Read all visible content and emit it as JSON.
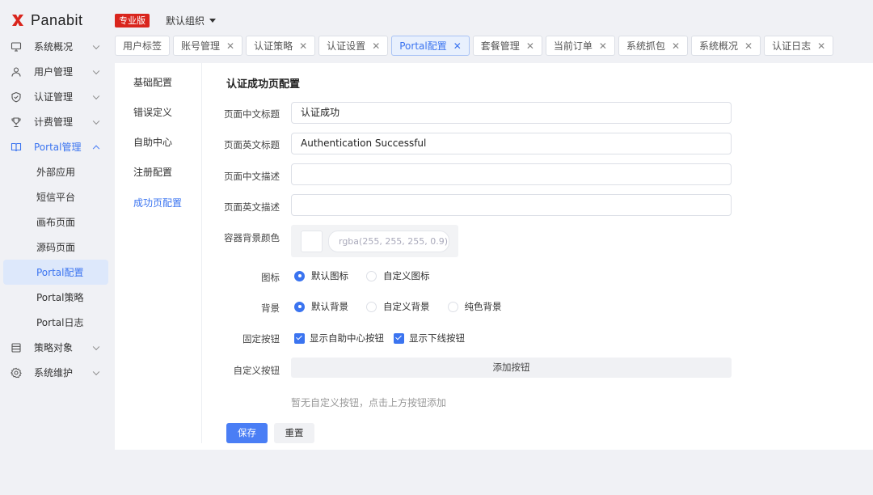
{
  "brand": {
    "name": "Panabit",
    "edition_badge": "专业版",
    "accent": "#d9251d"
  },
  "header": {
    "org_selector": "默认组织"
  },
  "sidebar": {
    "items": [
      {
        "label": "系统概况",
        "icon": "monitor-icon"
      },
      {
        "label": "用户管理",
        "icon": "user-icon"
      },
      {
        "label": "认证管理",
        "icon": "shield-icon"
      },
      {
        "label": "计费管理",
        "icon": "trophy-icon"
      },
      {
        "label": "Portal管理",
        "icon": "book-icon",
        "expanded": true
      },
      {
        "label": "策略对象",
        "icon": "list-icon"
      },
      {
        "label": "系统维护",
        "icon": "gear-icon"
      }
    ],
    "portal_sub": [
      "外部应用",
      "短信平台",
      "画布页面",
      "源码页面",
      "Portal配置",
      "Portal策略",
      "Portal日志"
    ],
    "active_sub": "Portal配置"
  },
  "tabs": [
    {
      "label": "用户标签",
      "closable": false
    },
    {
      "label": "账号管理",
      "closable": true
    },
    {
      "label": "认证策略",
      "closable": true
    },
    {
      "label": "认证设置",
      "closable": true
    },
    {
      "label": "Portal配置",
      "closable": true,
      "active": true
    },
    {
      "label": "套餐管理",
      "closable": true
    },
    {
      "label": "当前订单",
      "closable": true
    },
    {
      "label": "系统抓包",
      "closable": true
    },
    {
      "label": "系统概况",
      "closable": true
    },
    {
      "label": "认证日志",
      "closable": true
    }
  ],
  "subnav": [
    "基础配置",
    "错误定义",
    "自助中心",
    "注册配置",
    "成功页配置"
  ],
  "subnav_active": "成功页配置",
  "form": {
    "title": "认证成功页配置",
    "cn_title_label": "页面中文标题",
    "cn_title_value": "认证成功",
    "en_title_label": "页面英文标题",
    "en_title_value": "Authentication Successful",
    "cn_desc_label": "页面中文描述",
    "cn_desc_value": "",
    "en_desc_label": "页面英文描述",
    "en_desc_value": "",
    "bg_color_label": "容器背景颜色",
    "bg_color_placeholder": "rgba(255, 255, 255, 0.9)",
    "icon_label": "图标",
    "icon_options": [
      "默认图标",
      "自定义图标"
    ],
    "icon_selected": "默认图标",
    "bg_label": "背景",
    "bg_options": [
      "默认背景",
      "自定义背景",
      "纯色背景"
    ],
    "bg_selected": "默认背景",
    "fixed_btn_label": "固定按钮",
    "fixed_btn_options": [
      "显示自助中心按钮",
      "显示下线按钮"
    ],
    "custom_btn_label": "自定义按钮",
    "add_btn": "添加按钮",
    "empty_hint": "暂无自定义按钮，点击上方按钮添加",
    "save": "保存",
    "reset": "重置"
  }
}
